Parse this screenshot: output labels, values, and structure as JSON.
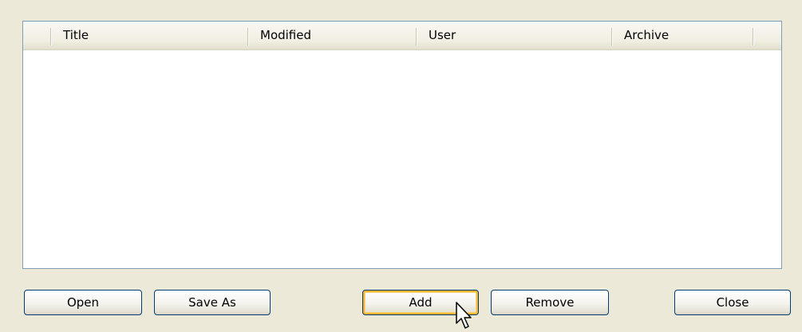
{
  "list": {
    "columns": [
      "Title",
      "Modified",
      "User",
      "Archive"
    ],
    "rows": []
  },
  "buttons": {
    "open": "Open",
    "save_as": "Save As",
    "add": "Add",
    "remove": "Remove",
    "close": "Close"
  },
  "icons": {
    "cursor": "mouse-pointer-icon"
  }
}
